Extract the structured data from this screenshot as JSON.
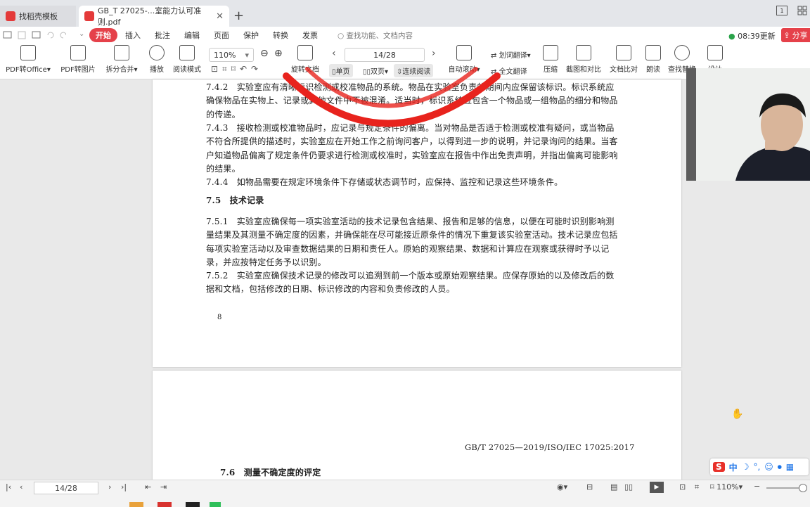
{
  "tabs": [
    {
      "label": "找稻壳模板"
    },
    {
      "label": "GB_T 27025-...室能力认可准则.pdf"
    }
  ],
  "window": {
    "new_tab": "+",
    "restore_label": "1"
  },
  "menu": {
    "items": [
      "开始",
      "插入",
      "批注",
      "编辑",
      "页面",
      "保护",
      "转换",
      "发票"
    ],
    "search_placeholder": "查找功能、文档内容",
    "update": "08:39更新",
    "share": "分享"
  },
  "toolbar": {
    "pdf_to_office": "PDF转Office",
    "pdf_to_image": "PDF转图片",
    "split_merge": "拆分合并",
    "play": "播放",
    "read_mode": "阅读模式",
    "zoom": "110%",
    "rotate": "旋转文档",
    "page": "14/28",
    "single": "单页",
    "double": "双页",
    "continuous": "连续阅读",
    "auto_scroll": "自动滚动",
    "word_translate": "划词翻译",
    "full_translate": "全文翻译",
    "compress": "压缩",
    "screenshot_compare": "截图和对比",
    "doc_compare": "文档比对",
    "read_aloud": "朗读",
    "find_replace": "查找替换",
    "more": "设计"
  },
  "document": {
    "p742": "7.4.2　实验室应有清晰标识检测或校准物品的系统。物品在实验室负责的期间内应保留该标识。标识系统应确保物品在实物上、记录或其他文件中不被混淆。适当时，标识系统应包含一个物品或一组物品的细分和物品的传递。",
    "p743": "7.4.3　接收检测或校准物品时，应记录与规定条件的偏离。当对物品是否适于检测或校准有疑问，或当物品不符合所提供的描述时，实验室应在开始工作之前询问客户，以得到进一步的说明，并记录询问的结果。当客户知道物品偏离了规定条件仍要求进行检测或校准时，实验室应在报告中作出免责声明，并指出偏离可能影响的结果。",
    "p744": "7.4.4　如物品需要在规定环境条件下存储或状态调节时，应保持、监控和记录这些环境条件。",
    "s75": "7.5　技术记录",
    "p751": "7.5.1　实验室应确保每一项实验室活动的技术记录包含结果、报告和足够的信息，以便在可能时识别影响测量结果及其测量不确定度的因素，并确保能在尽可能接近原条件的情况下重复该实验室活动。技术记录应包括每项实验室活动以及审查数据结果的日期和责任人。原始的观察结果、数据和计算应在观察或获得时予以记录，并应按特定任务予以识别。",
    "p752": "7.5.2　实验室应确保技术记录的修改可以追溯到前一个版本或原始观察结果。应保存原始的以及修改后的数据和文档，包括修改的日期、标识修改的内容和负责修改的人员。",
    "page_number": "8",
    "header2": "GB/T 27025—2019/ISO/IEC 17025:2017",
    "s76": "7.6　测量不确定度的评定"
  },
  "statusbar": {
    "page": "14/28",
    "zoom": "110%"
  },
  "ime": {
    "label": "中"
  },
  "colors": {
    "accent": "#e5414a",
    "annotation": "#e8231d"
  }
}
